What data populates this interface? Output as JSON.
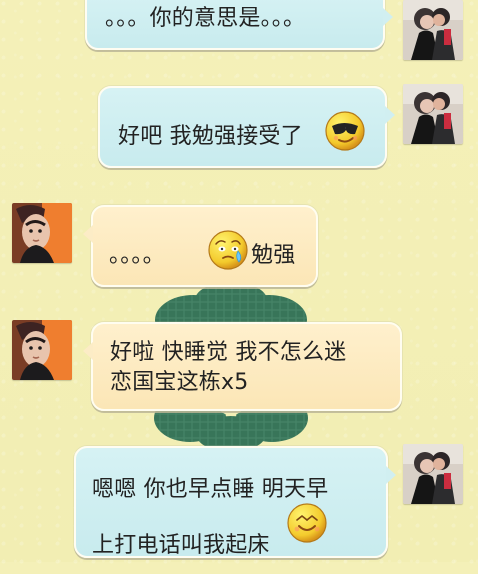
{
  "messages": [
    {
      "id": "m1",
      "direction": "outgoing",
      "text": "。。。你的意思是。。。"
    },
    {
      "id": "m2",
      "direction": "outgoing",
      "text": "好吧 我勉强接受了",
      "emoji": "cool-sunglasses-emoji"
    },
    {
      "id": "m3",
      "direction": "incoming",
      "text_before": "。。。。",
      "emoji": "teary-worried-emoji",
      "text_after": "勉强"
    },
    {
      "id": "m4",
      "direction": "incoming",
      "text": "好啦 快睡觉 我不怎么迷\n恋国宝这栋x5"
    },
    {
      "id": "m5",
      "direction": "outgoing",
      "text": "嗯嗯 你也早点睡 明天早\n上打电话叫我起床",
      "emoji": "smiling-emoji"
    }
  ],
  "avatars": {
    "outgoing": "couple-photo-avatar",
    "incoming": "portrait-avatar"
  },
  "colors": {
    "background": "#f3efb7",
    "outgoing_bubble": "#c8ebee",
    "incoming_bubble": "#fbe6b6",
    "text": "#222222",
    "wallpaper_knot": "#2f6f55"
  }
}
